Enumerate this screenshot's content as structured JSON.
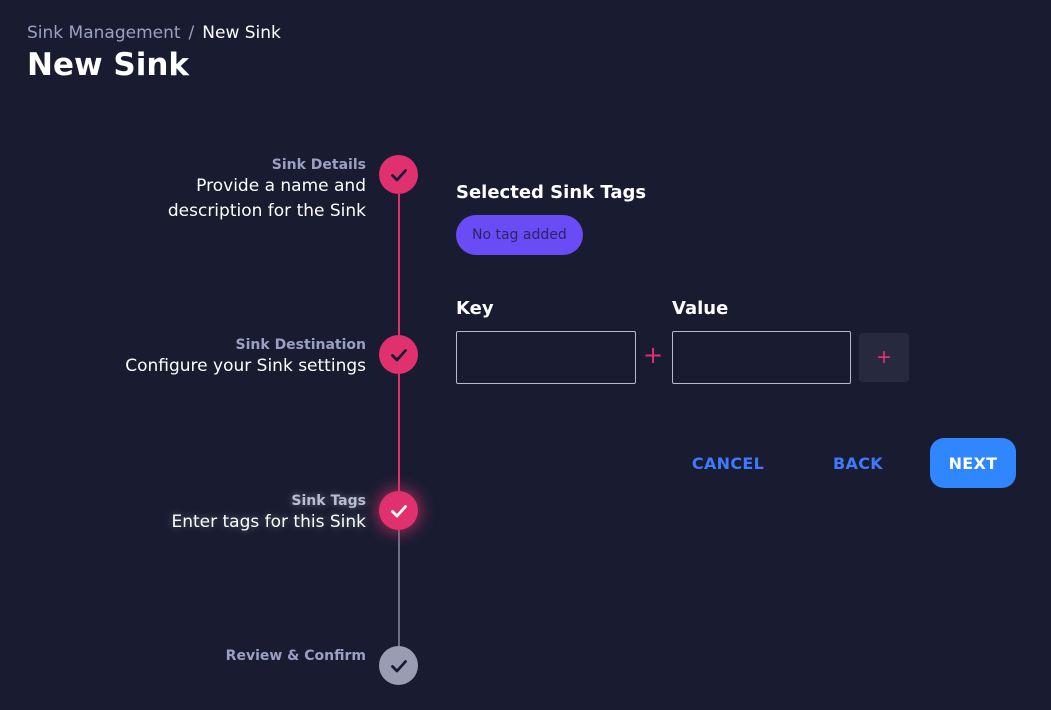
{
  "breadcrumb": {
    "parent": "Sink Management",
    "separator": "/",
    "current": "New Sink"
  },
  "page_title": "New Sink",
  "stepper": {
    "steps": [
      {
        "title": "Sink Details",
        "description": "Provide a name and",
        "description_line2": "description for the Sink",
        "status": "completed"
      },
      {
        "title": "Sink Destination",
        "description": "Configure your Sink settings",
        "status": "completed"
      },
      {
        "title": "Sink Tags",
        "description": "Enter tags for this Sink",
        "status": "active"
      },
      {
        "title": "Review & Confirm",
        "description": "",
        "status": "pending"
      }
    ]
  },
  "tags": {
    "heading": "Selected Sink Tags",
    "empty_chip": "No tag added",
    "key_label": "Key",
    "value_label": "Value",
    "key_value": "",
    "value_value": "",
    "separator_symbol": "+",
    "add_symbol": "+"
  },
  "actions": {
    "cancel": "CANCEL",
    "back": "BACK",
    "next": "NEXT"
  },
  "colors": {
    "background": "#191c31",
    "accent_pink": "#e0316e",
    "primary_blue": "#2f86ff",
    "link_blue": "#3d7aff",
    "chip_purple": "#6a4cf6"
  },
  "icons": {
    "step_completed": "check-icon",
    "add": "plus-icon"
  }
}
